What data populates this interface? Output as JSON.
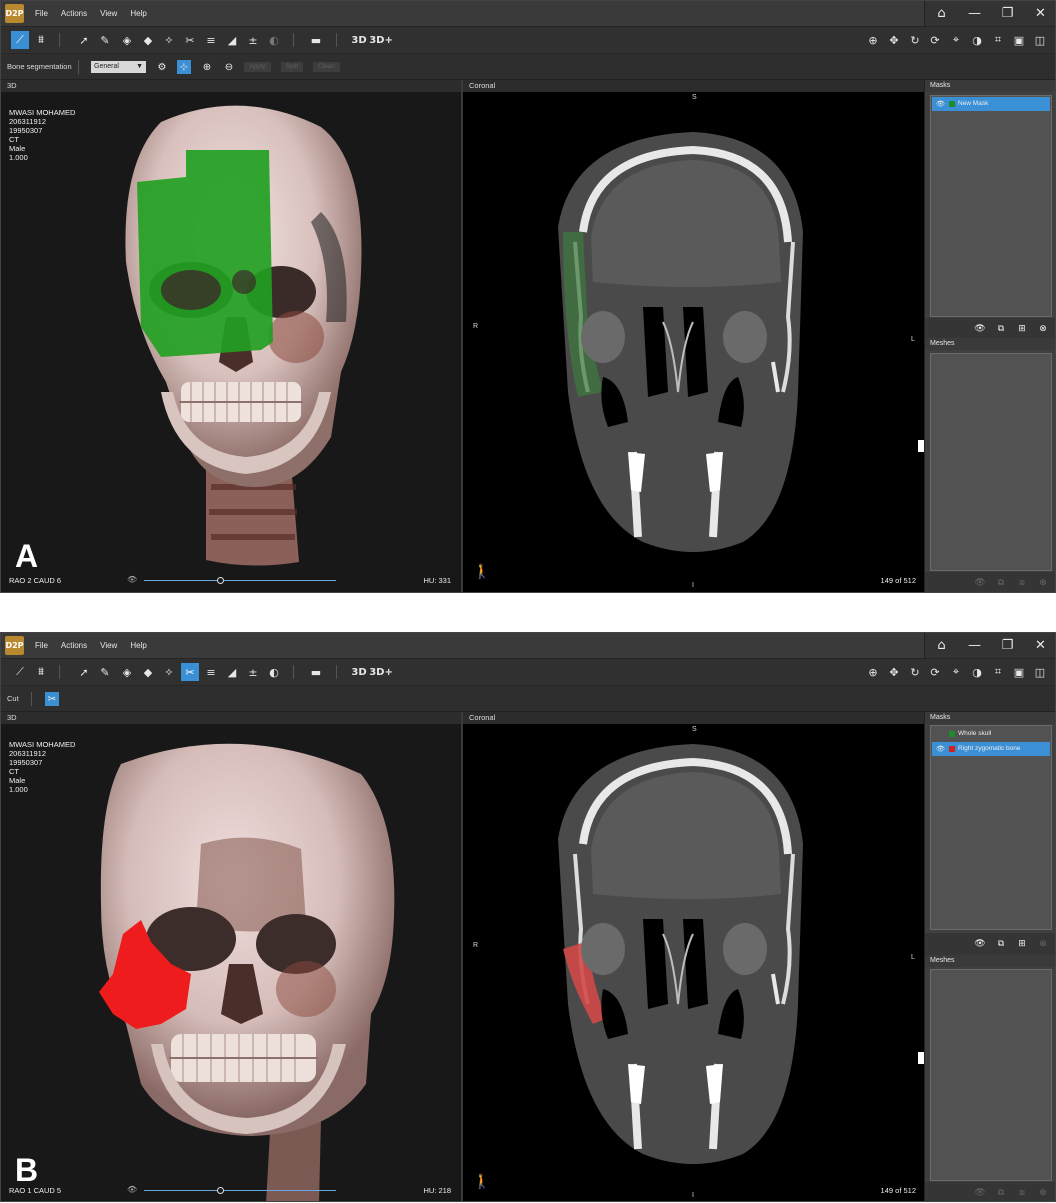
{
  "app": {
    "logo": "D2P",
    "menu": [
      "File",
      "Actions",
      "View",
      "Help"
    ],
    "window_controls": [
      "home-icon",
      "minimize-icon",
      "restore-icon",
      "close-icon"
    ]
  },
  "panels": [
    {
      "id": "A",
      "panel_label": "A",
      "option_bar": {
        "label": "Bone segmentation",
        "preset": "General",
        "buttons": [
          "Apply",
          "Split",
          "Clean"
        ]
      },
      "view3d": {
        "header": "3D",
        "patient": [
          "MWASI MOHAMED",
          "206311912",
          "19950307",
          "CT",
          "Male",
          "1.000"
        ],
        "orientation": "RAO 2  CAUD  6",
        "hu": "HU: 331",
        "slider_value": 0.4,
        "mask_color": "#22a022"
      },
      "coronal": {
        "header": "Coronal",
        "top": "S",
        "bottom": "I",
        "left": "R",
        "right": "L",
        "slice": "149 of 512"
      },
      "masks": {
        "header": "Masks",
        "items": [
          {
            "label": "New Mask",
            "color": "#1e8c2a",
            "selected": true
          }
        ]
      },
      "meshes": {
        "header": "Meshes"
      }
    },
    {
      "id": "B",
      "panel_label": "B",
      "option_bar": {
        "label": "Cut"
      },
      "view3d": {
        "header": "3D",
        "patient": [
          "MWASI MOHAMED",
          "206311912",
          "19950307",
          "CT",
          "Male",
          "1.000"
        ],
        "orientation": "RAO 1  CAUD  5",
        "hu": "HU: 218",
        "slider_value": 0.4,
        "mask_color": "#ee1c1c"
      },
      "coronal": {
        "header": "Coronal",
        "top": "S",
        "bottom": "I",
        "left": "R",
        "right": "L",
        "slice": "149 of 512"
      },
      "masks": {
        "header": "Masks",
        "items": [
          {
            "label": "Whole skull",
            "color": "#1e8c2a",
            "selected": false
          },
          {
            "label": "Right zygomatic bone",
            "color": "#d42020",
            "selected": true
          }
        ]
      },
      "meshes": {
        "header": "Meshes"
      }
    }
  ],
  "toolbar": {
    "view_3d": "3D",
    "view_3d_plus": "3D+"
  }
}
